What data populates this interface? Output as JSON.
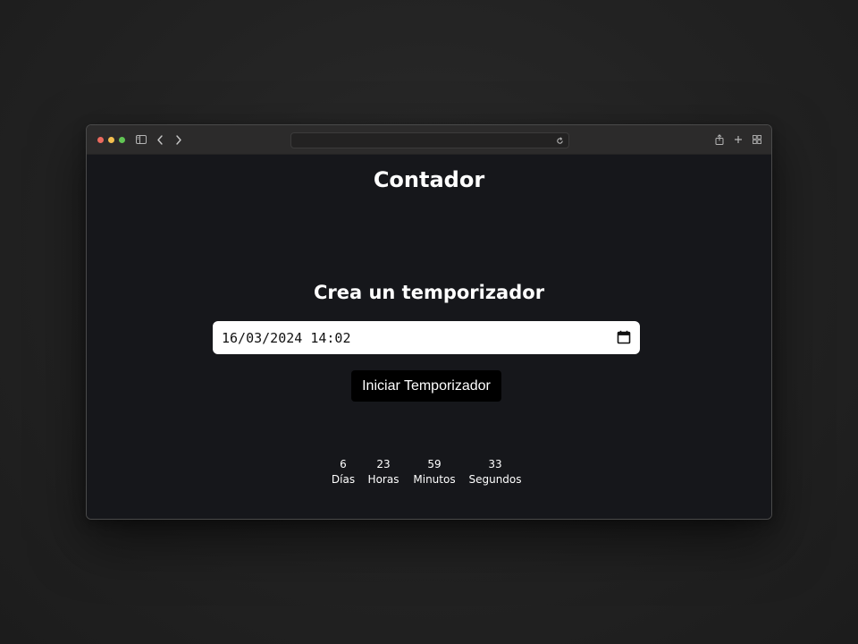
{
  "window": {
    "url": "",
    "traffic_lights": {
      "close": "#ec6a5e",
      "minimize": "#f4bf4f",
      "maximize": "#61c554"
    }
  },
  "app": {
    "title": "Contador"
  },
  "timer_form": {
    "heading": "Crea un temporizador",
    "datetime_value": "16/03/2024 14:02",
    "start_button_label": "Iniciar Temporizador"
  },
  "countdown": {
    "days": {
      "value": "6",
      "label": "Días"
    },
    "hours": {
      "value": "23",
      "label": "Horas"
    },
    "minutes": {
      "value": "59",
      "label": "Minutos"
    },
    "seconds": {
      "value": "33",
      "label": "Segundos"
    }
  },
  "icons": {
    "sidebar": "sidebar-icon",
    "back": "chevron-left-icon",
    "forward": "chevron-right-icon",
    "reload": "reload-icon",
    "share": "share-icon",
    "new_tab": "plus-icon",
    "tab_overview": "tab-grid-icon",
    "calendar": "calendar-icon"
  },
  "colors": {
    "page_background": "#16171b",
    "titlebar": "#2c2b2b",
    "button_background": "#000000",
    "text": "#ffffff"
  }
}
